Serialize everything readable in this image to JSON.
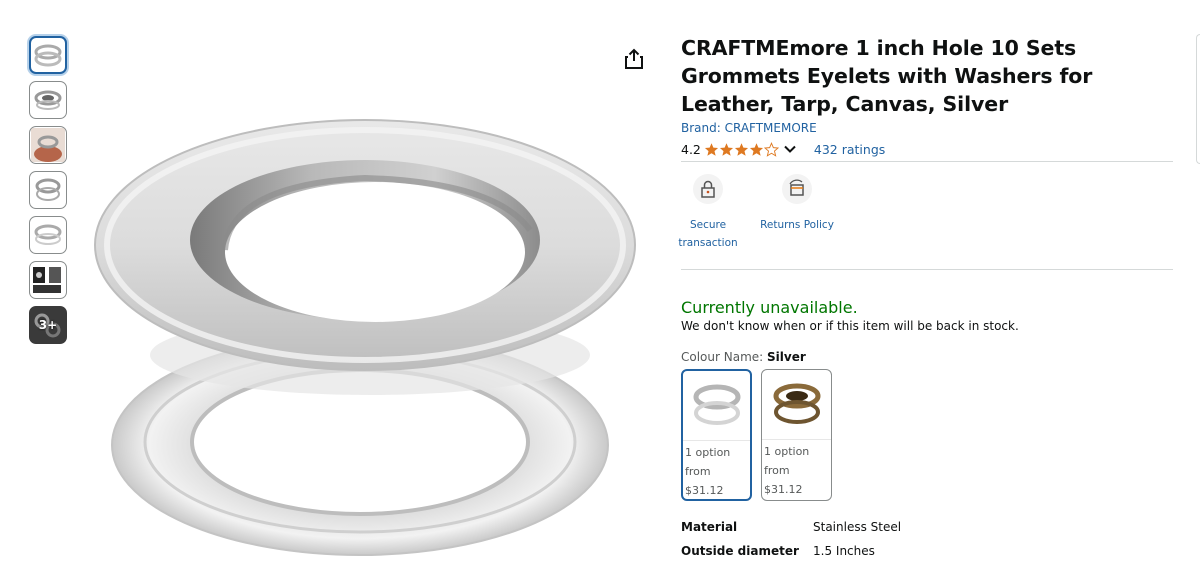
{
  "thumbnails": [
    {
      "name": "thumb-grommet-front",
      "selected": true
    },
    {
      "name": "thumb-grommet-side",
      "selected": false
    },
    {
      "name": "thumb-grommet-hand",
      "selected": false
    },
    {
      "name": "thumb-grommet-size",
      "selected": false
    },
    {
      "name": "thumb-grommet-washer",
      "selected": false
    },
    {
      "name": "thumb-grommet-tools",
      "selected": false
    },
    {
      "name": "thumb-more",
      "selected": false,
      "label": "3+"
    }
  ],
  "product": {
    "title": "CRAFTMEmore 1 inch Hole 10 Sets Grommets Eyelets with Washers for Leather, Tarp, Canvas, Silver",
    "brand": "Brand: CRAFTMEMORE",
    "rating": "4.2",
    "rating_value": 4.2,
    "ratings_count": "432 ratings"
  },
  "badges": {
    "secure": "Secure transaction",
    "returns": "Returns Policy"
  },
  "availability": {
    "status": "Currently unavailable.",
    "note": "We don't know when or if this item will be back in stock."
  },
  "colour": {
    "label": "Colour Name:",
    "selected": "Silver",
    "options": [
      {
        "line1": "1 option",
        "line2": "from",
        "price": "$31.12",
        "color": "#c8c8c8"
      },
      {
        "line1": "1 option",
        "line2": "from",
        "price": "$31.12",
        "color": "#8a6a3a"
      }
    ]
  },
  "specs": [
    {
      "key": "Material",
      "value": "Stainless Steel"
    },
    {
      "key": "Outside diameter",
      "value": "1.5 Inches"
    }
  ],
  "colors": {
    "link": "#2162a1",
    "star": "#de7921",
    "available": "#007600"
  }
}
